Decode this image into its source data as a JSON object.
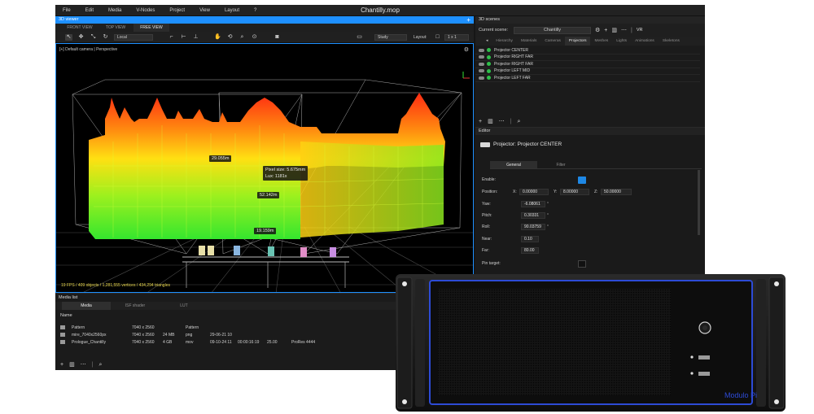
{
  "menu": [
    "File",
    "Edit",
    "Media",
    "V-Nodes",
    "Project",
    "View",
    "Layout",
    "?"
  ],
  "window_title": "Chantilly.mop",
  "viewport": {
    "panel_title": "3D viewer",
    "views": [
      {
        "label": "FRONT VIEW",
        "active": false
      },
      {
        "label": "TOP VIEW",
        "active": false
      },
      {
        "label": "FREE VIEW",
        "active": true
      }
    ],
    "transform_space": "Local",
    "study_mode": "Study",
    "layout_label": "Layout:",
    "layout_value": "1 x 1",
    "camera_label": "[+] Default camera | Perspective",
    "stats": "19 FPS / 409 objects / 1,281,555 vertices / 434,294 triangles",
    "measurements": {
      "width_left": "29.055m",
      "pixel_size": "Pixel size: 5.675mm",
      "lux": "Lux: 1181x",
      "height": "52.142m",
      "depth": "19.159m"
    }
  },
  "scenes": {
    "panel_title": "3D scenes",
    "current_label": "Current scene:",
    "current_value": "Chantilly",
    "vr_label": "VR",
    "tabs": [
      {
        "label": "Hierarchy",
        "active": false
      },
      {
        "label": "Materials",
        "active": false
      },
      {
        "label": "Cameras",
        "active": false
      },
      {
        "label": "Projectors",
        "active": true
      },
      {
        "label": "Meshes",
        "active": false
      },
      {
        "label": "Lights",
        "active": false
      },
      {
        "label": "Animations",
        "active": false
      },
      {
        "label": "Skeletons",
        "active": false
      }
    ],
    "projectors": [
      "Projector CENTER",
      "Projector RIGHT FAR",
      "Projector RIGHT FAR",
      "Projector LEFT MID",
      "Projector LEFT FAR"
    ]
  },
  "editor": {
    "panel_title": "Editor",
    "object_title": "Projector: Projector CENTER",
    "tabs": [
      {
        "label": "General",
        "active": true
      },
      {
        "label": "Filter",
        "active": false
      }
    ],
    "enable_label": "Enable:",
    "position_label": "Position:",
    "x_label": "X:",
    "x_value": "0.00000",
    "y_label": "Y:",
    "y_value": "8.00000",
    "z_label": "Z:",
    "z_value": "50.00000",
    "yaw_label": "Yaw:",
    "yaw_value": "-6.08061",
    "pitch_label": "Pitch:",
    "pitch_value": "0.30331",
    "roll_label": "Roll:",
    "roll_value": "90.03759",
    "near_label": "Near:",
    "near_value": "0.10",
    "far_label": "Far:",
    "far_value": "80.00",
    "pin_label": "Pin target:"
  },
  "media": {
    "panel_title": "Media list",
    "tabs": [
      {
        "label": "Media",
        "active": true
      },
      {
        "label": "ISF shader",
        "active": false
      },
      {
        "label": "LUT",
        "active": false
      }
    ],
    "name_header": "Name",
    "rows": [
      {
        "name": "Pattern",
        "res": "7040 x 2560",
        "size": "",
        "type": "Pattern",
        "date": "",
        "dur": "",
        "fps": "",
        "codec": ""
      },
      {
        "name": "mire_7040x2560px",
        "res": "7040 x 2560",
        "size": "24 MB",
        "type": "png",
        "date": "29-06-21 10",
        "dur": "",
        "fps": "",
        "codec": ""
      },
      {
        "name": "Prologue_Chantilly",
        "res": "7040 x 2560",
        "size": "4 GB",
        "type": "mov",
        "date": "09-10-24 11",
        "dur": "00:00:16:19",
        "fps": "25.00",
        "codec": "ProRes 4444"
      }
    ]
  },
  "hardware": {
    "brand": "Modulo Pi",
    "led_color": "#2d4bd6"
  },
  "colors": {
    "accent": "#1e90ff",
    "panel": "#1b1b1b",
    "status_green": "#2fbf4a",
    "stats_yellow": "#e8d64a"
  }
}
